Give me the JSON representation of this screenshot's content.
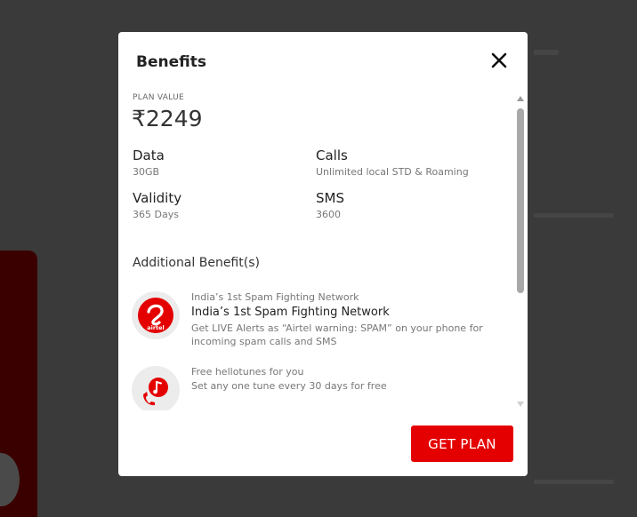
{
  "modal": {
    "title": "Benefits",
    "close_icon": "close-icon"
  },
  "plan": {
    "value_label": "PLAN VALUE",
    "value": "₹2249"
  },
  "specs": [
    {
      "label": "Data",
      "value": "30GB"
    },
    {
      "label": "Calls",
      "value": "Unlimited local STD & Roaming"
    },
    {
      "label": "Validity",
      "value": "365 Days"
    },
    {
      "label": "SMS",
      "value": "3600"
    }
  ],
  "additional": {
    "title": "Additional Benefit(s)",
    "items": [
      {
        "icon": "airtel-logo-icon",
        "logo_text": "airtel",
        "subtitle": "India’s 1st Spam Fighting Network",
        "title": "India’s 1st Spam Fighting Network",
        "description": "Get LIVE Alerts as “Airtel warning: SPAM” on your phone for incoming spam calls and SMS"
      },
      {
        "icon": "hellotunes-icon",
        "subtitle": "Free hellotunes for you",
        "description": "Set any one tune every 30 days for free"
      }
    ]
  },
  "cta": {
    "label": "GET PLAN"
  },
  "colors": {
    "brand_red": "#e40000",
    "overlay": "#3a3a3a"
  }
}
